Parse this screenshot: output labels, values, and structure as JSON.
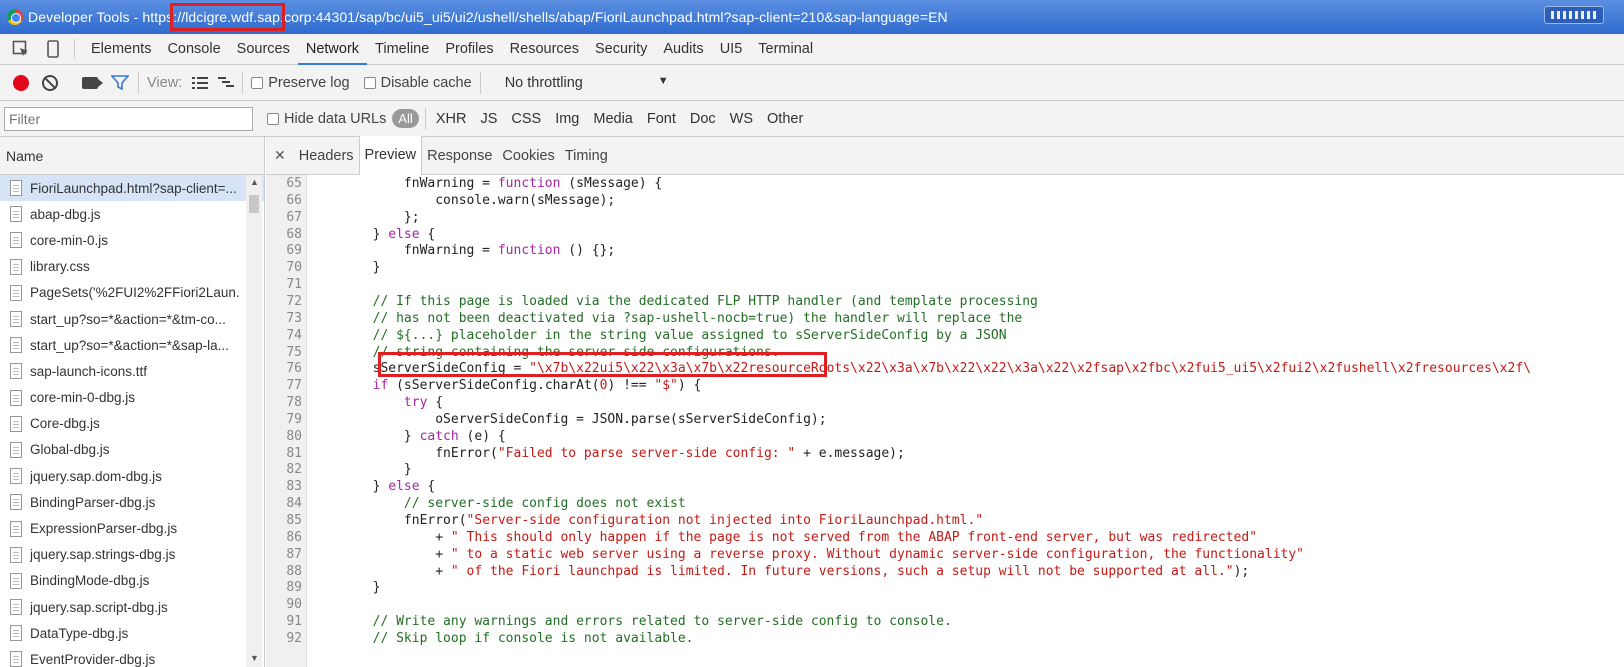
{
  "window": {
    "title": "Developer Tools - https://ldcigre.wdf.sap.corp:44301/sap/bc/ui5_ui5/ui2/ushell/shells/abap/FioriLaunchpad.html?sap-client=210&sap-language=EN"
  },
  "main_tabs": [
    "Elements",
    "Console",
    "Sources",
    "Network",
    "Timeline",
    "Profiles",
    "Resources",
    "Security",
    "Audits",
    "UI5",
    "Terminal"
  ],
  "network_toolbar": {
    "view_label": "View:",
    "preserve_log": "Preserve log",
    "disable_cache": "Disable cache",
    "throttling": "No throttling"
  },
  "filter_bar": {
    "placeholder": "Filter",
    "hide_data_urls": "Hide data URLs",
    "all": "All",
    "types": [
      "XHR",
      "JS",
      "CSS",
      "Img",
      "Media",
      "Font",
      "Doc",
      "WS",
      "Other"
    ]
  },
  "name_panel": {
    "header": "Name",
    "files": [
      "FioriLaunchpad.html?sap-client=...",
      "abap-dbg.js",
      "core-min-0.js",
      "library.css",
      "PageSets('%2FUI2%2FFiori2Laun...",
      "start_up?so=*&action=*&tm-co...",
      "start_up?so=*&action=*&sap-la...",
      "sap-launch-icons.ttf",
      "core-min-0-dbg.js",
      "Core-dbg.js",
      "Global-dbg.js",
      "jquery.sap.dom-dbg.js",
      "BindingParser-dbg.js",
      "ExpressionParser-dbg.js",
      "jquery.sap.strings-dbg.js",
      "BindingMode-dbg.js",
      "jquery.sap.script-dbg.js",
      "DataType-dbg.js",
      "EventProvider-dbg.js"
    ]
  },
  "detail_tabs": [
    "Headers",
    "Preview",
    "Response",
    "Cookies",
    "Timing"
  ],
  "code_lines": [
    {
      "n": "65",
      "parts": [
        [
          "plain",
          "            fnWarning = "
        ],
        [
          "kw",
          "function"
        ],
        [
          "plain",
          " (sMessage) {"
        ]
      ]
    },
    {
      "n": "66",
      "parts": [
        [
          "plain",
          "                console.warn(sMessage);"
        ]
      ]
    },
    {
      "n": "67",
      "parts": [
        [
          "plain",
          "            };"
        ]
      ]
    },
    {
      "n": "68",
      "parts": [
        [
          "plain",
          "        } "
        ],
        [
          "kw",
          "else"
        ],
        [
          "plain",
          " {"
        ]
      ]
    },
    {
      "n": "69",
      "parts": [
        [
          "plain",
          "            fnWarning = "
        ],
        [
          "kw",
          "function"
        ],
        [
          "plain",
          " () {};"
        ]
      ]
    },
    {
      "n": "70",
      "parts": [
        [
          "plain",
          "        }"
        ]
      ]
    },
    {
      "n": "71",
      "parts": [
        [
          "plain",
          ""
        ]
      ]
    },
    {
      "n": "72",
      "parts": [
        [
          "cm",
          "        // If this page is loaded via the dedicated FLP HTTP handler (and template processing"
        ]
      ]
    },
    {
      "n": "73",
      "parts": [
        [
          "cm",
          "        // has not been deactivated via ?sap-ushell-nocb=true) the handler will replace the"
        ]
      ]
    },
    {
      "n": "74",
      "parts": [
        [
          "cm",
          "        // ${...} placeholder in the string value assigned to sServerSideConfig by a JSON"
        ]
      ]
    },
    {
      "n": "75",
      "parts": [
        [
          "cm",
          "        // string containing the server side configurations."
        ]
      ]
    },
    {
      "n": "76",
      "parts": [
        [
          "plain",
          "        sServerSideConfig = "
        ],
        [
          "str",
          "\"\\x7b\\x22ui5\\x22\\x3a\\x7b\\x22resourceRoots\\x22\\x3a\\x7b\\x22\\x22\\x3a\\x22\\x2fsap\\x2fbc\\x2fui5_ui5\\x2fui2\\x2fushell\\x2fresources\\x2f\\"
        ]
      ]
    },
    {
      "n": "77",
      "parts": [
        [
          "kw",
          "        if"
        ],
        [
          "plain",
          " (sServerSideConfig.charAt("
        ],
        [
          "str",
          "0"
        ],
        [
          "plain",
          ") !== "
        ],
        [
          "str",
          "\"$\""
        ],
        [
          "plain",
          ") {"
        ]
      ]
    },
    {
      "n": "78",
      "parts": [
        [
          "kw",
          "            try"
        ],
        [
          "plain",
          " {"
        ]
      ]
    },
    {
      "n": "79",
      "parts": [
        [
          "plain",
          "                oServerSideConfig = JSON.parse(sServerSideConfig);"
        ]
      ]
    },
    {
      "n": "80",
      "parts": [
        [
          "plain",
          "            } "
        ],
        [
          "kw",
          "catch"
        ],
        [
          "plain",
          " (e) {"
        ]
      ]
    },
    {
      "n": "81",
      "parts": [
        [
          "plain",
          "                fnError("
        ],
        [
          "str",
          "\"Failed to parse server-side config: \""
        ],
        [
          "plain",
          " + e.message);"
        ]
      ]
    },
    {
      "n": "82",
      "parts": [
        [
          "plain",
          "            }"
        ]
      ]
    },
    {
      "n": "83",
      "parts": [
        [
          "plain",
          "        } "
        ],
        [
          "kw",
          "else"
        ],
        [
          "plain",
          " {"
        ]
      ]
    },
    {
      "n": "84",
      "parts": [
        [
          "cm",
          "            // server-side config does not exist"
        ]
      ]
    },
    {
      "n": "85",
      "parts": [
        [
          "plain",
          "            fnError("
        ],
        [
          "str",
          "\"Server-side configuration not injected into FioriLaunchpad.html.\""
        ]
      ]
    },
    {
      "n": "86",
      "parts": [
        [
          "plain",
          "                + "
        ],
        [
          "str",
          "\" This should only happen if the page is not served from the ABAP front-end server, but was redirected\""
        ]
      ]
    },
    {
      "n": "87",
      "parts": [
        [
          "plain",
          "                + "
        ],
        [
          "str",
          "\" to a static web server using a reverse proxy. Without dynamic server-side configuration, the functionality\""
        ]
      ]
    },
    {
      "n": "88",
      "parts": [
        [
          "plain",
          "                + "
        ],
        [
          "str",
          "\" of the Fiori launchpad is limited. In future versions, such a setup will not be supported at all.\""
        ],
        [
          "plain",
          ");"
        ]
      ]
    },
    {
      "n": "89",
      "parts": [
        [
          "plain",
          "        }"
        ]
      ]
    },
    {
      "n": "90",
      "parts": [
        [
          "plain",
          ""
        ]
      ]
    },
    {
      "n": "91",
      "parts": [
        [
          "cm",
          "        // Write any warnings and errors related to server-side config to console."
        ]
      ]
    },
    {
      "n": "92",
      "parts": [
        [
          "cm",
          "        // Skip loop if console is not available."
        ]
      ]
    }
  ]
}
